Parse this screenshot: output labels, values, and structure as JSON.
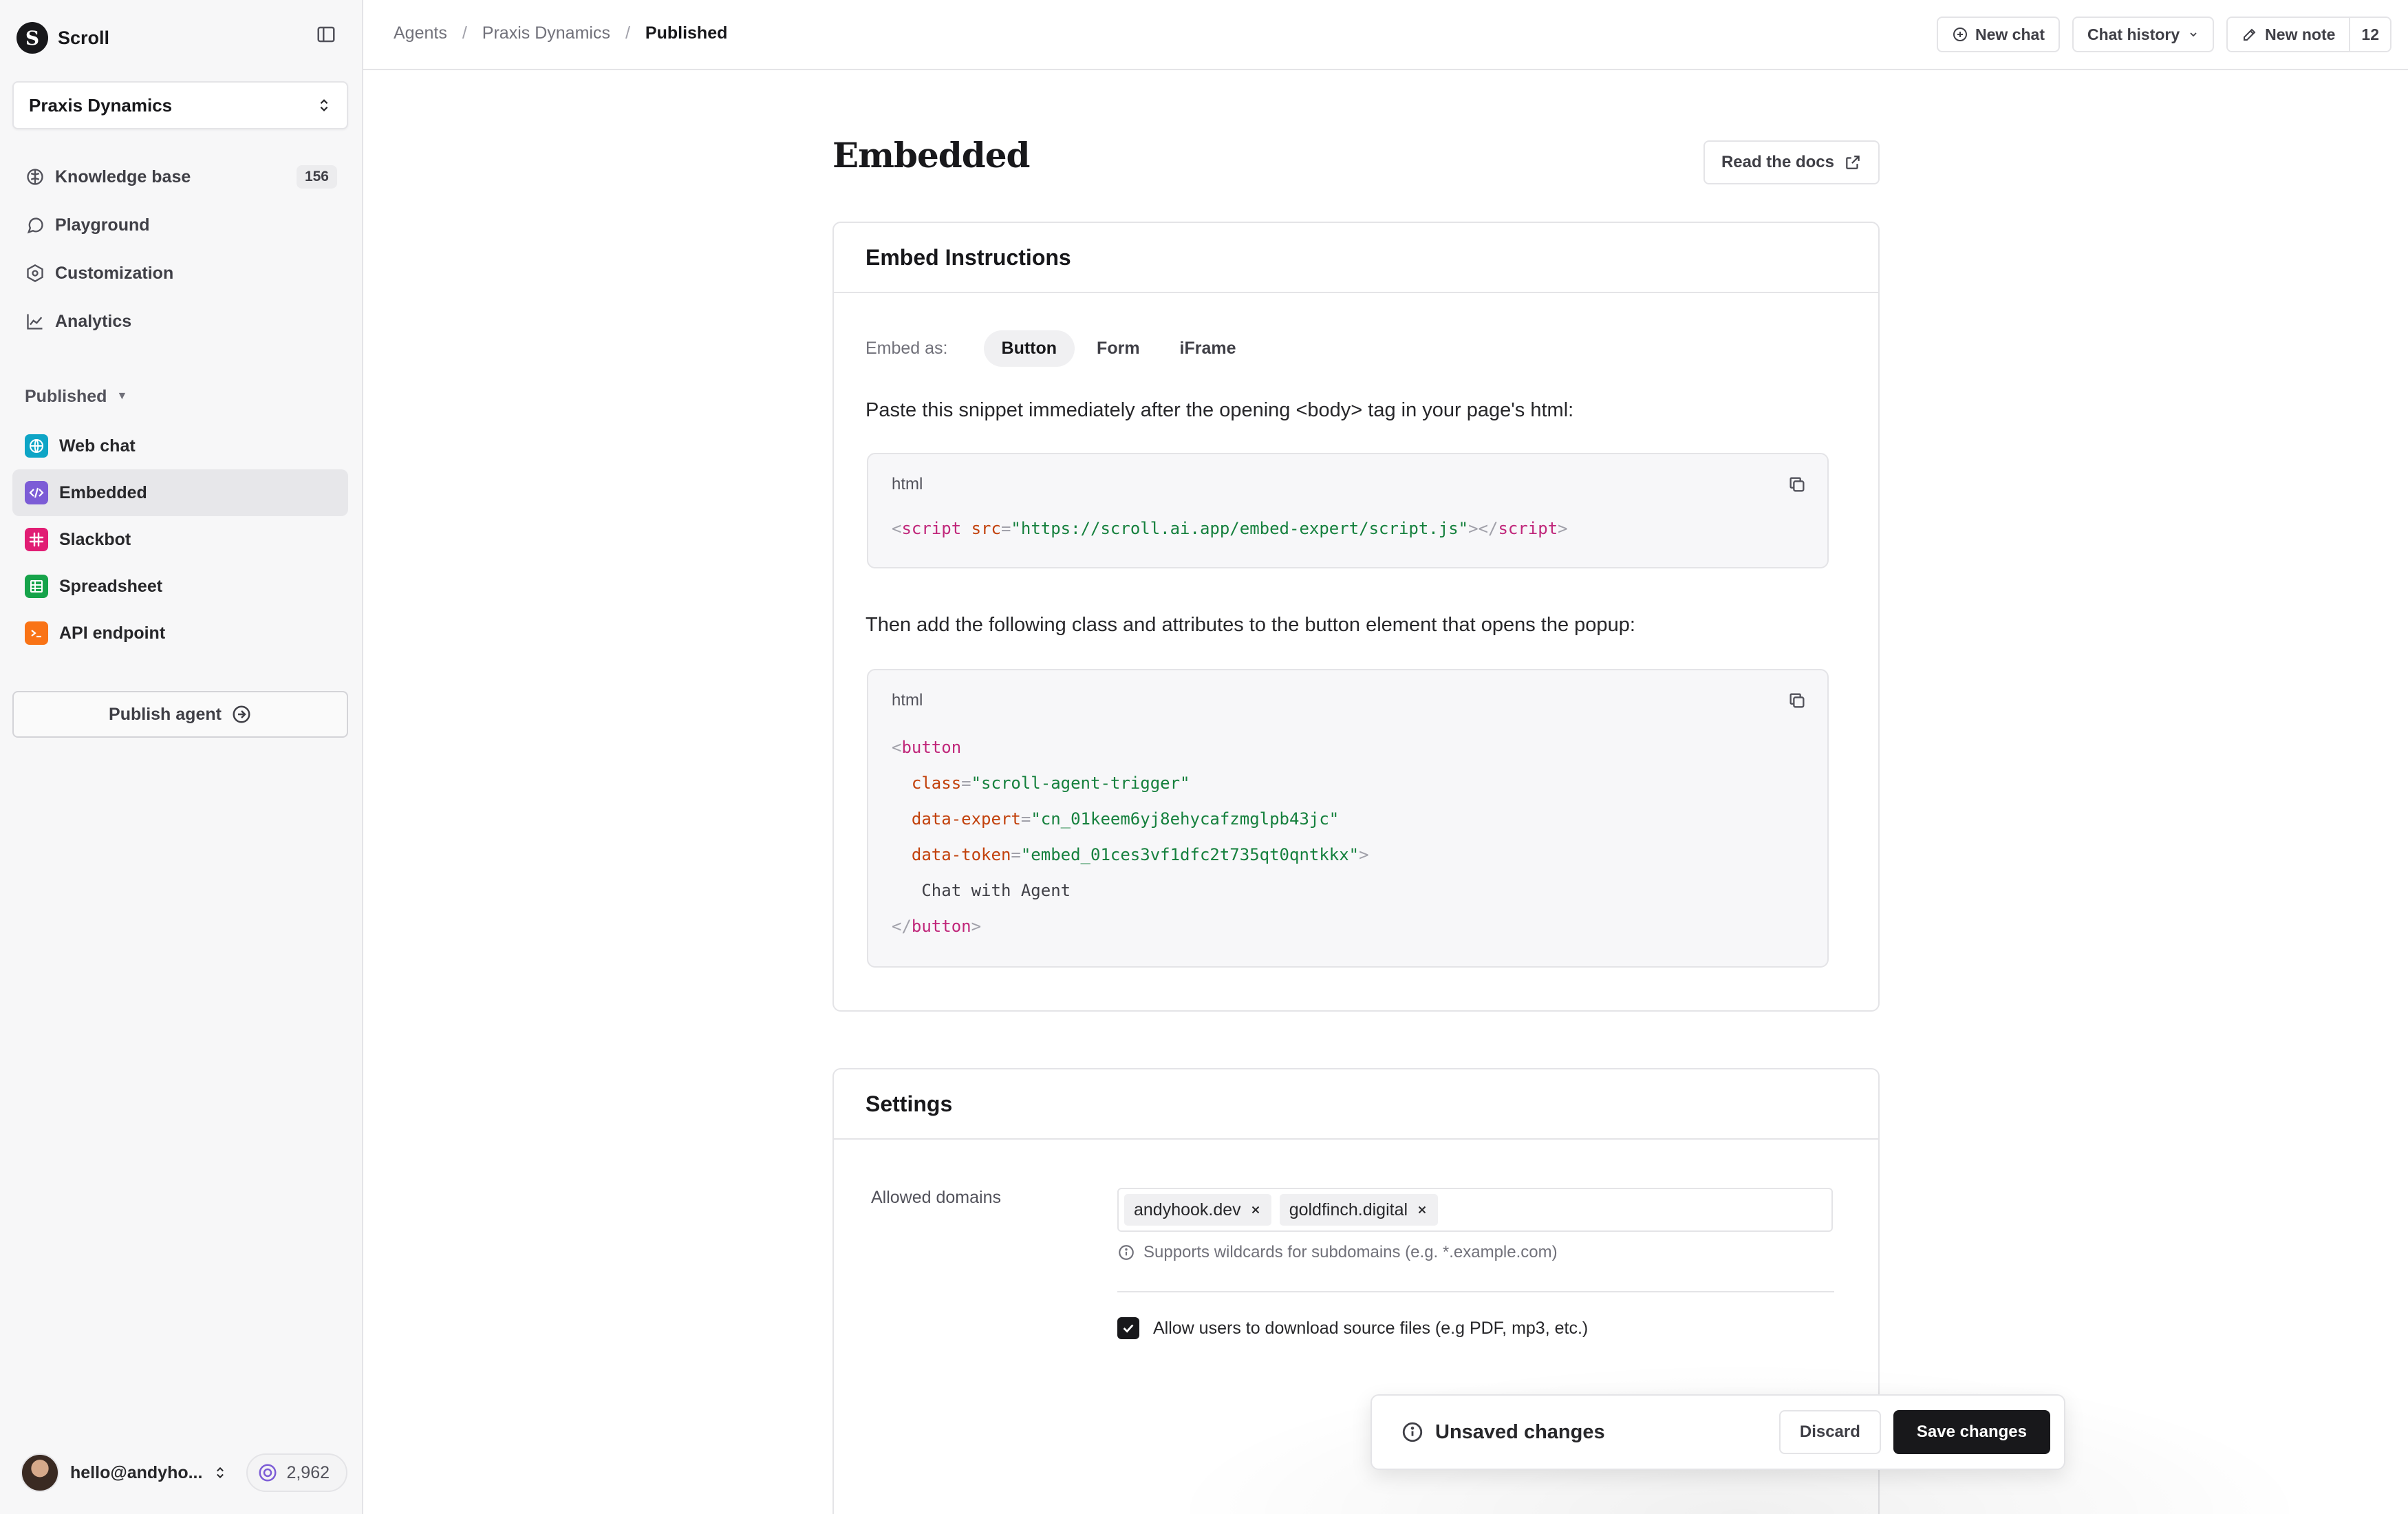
{
  "brand": {
    "name": "Scroll",
    "logo_letter": "S"
  },
  "workspace": {
    "name": "Praxis Dynamics"
  },
  "nav": {
    "items": [
      {
        "label": "Knowledge base",
        "icon": "brain-icon",
        "count": "156"
      },
      {
        "label": "Playground",
        "icon": "chat-bubble-icon"
      },
      {
        "label": "Customization",
        "icon": "hexagon-settings-icon"
      },
      {
        "label": "Analytics",
        "icon": "line-chart-icon"
      }
    ]
  },
  "published": {
    "section_label": "Published",
    "items": [
      {
        "label": "Web chat",
        "icon": "globe-icon",
        "color": "#0ea5c6"
      },
      {
        "label": "Embedded",
        "icon": "code-icon",
        "color": "#7c5cd6",
        "active": true
      },
      {
        "label": "Slackbot",
        "icon": "slack-icon",
        "color": "#e11d74"
      },
      {
        "label": "Spreadsheet",
        "icon": "table-icon",
        "color": "#16a34a"
      },
      {
        "label": "API endpoint",
        "icon": "terminal-icon",
        "color": "#f97316"
      }
    ]
  },
  "publish_button": {
    "label": "Publish agent"
  },
  "user": {
    "email": "hello@andyho...",
    "credits": "2,962"
  },
  "breadcrumb": {
    "items": [
      "Agents",
      "Praxis Dynamics"
    ],
    "current": "Published"
  },
  "topbar": {
    "new_chat": "New chat",
    "chat_history": "Chat history",
    "new_note": "New note",
    "note_count": "12"
  },
  "page": {
    "title": "Embedded",
    "docs_button": "Read the docs"
  },
  "embed": {
    "title": "Embed Instructions",
    "embed_as_label": "Embed as:",
    "tabs": [
      "Button",
      "Form",
      "iFrame"
    ],
    "active_tab": "Button",
    "instruction_1": "Paste this snippet immediately after the opening <body> tag in your page's html:",
    "code_lang_1": "html",
    "script_src": "\"https://scroll.ai.app/embed-expert/script.js\"",
    "instruction_2": "Then add the following class and attributes to the button element that opens the popup:",
    "code_lang_2": "html",
    "button_class": "\"scroll-agent-trigger\"",
    "data_expert": "\"cn_01keem6yj8ehycafzmglpb43jc\"",
    "data_token": "\"embed_01ces3vf1dfc2t735qt0qntkkx\"",
    "button_text": "Chat with Agent"
  },
  "settings": {
    "title": "Settings",
    "allowed_domains_label": "Allowed domains",
    "domains": [
      "andyhook.dev",
      "goldfinch.digital"
    ],
    "hint": "Supports wildcards for subdomains (e.g. *.example.com)",
    "download_checkbox_label": "Allow users to download source files (e.g PDF, mp3, etc.)",
    "download_checked": true
  },
  "unsaved": {
    "message": "Unsaved changes",
    "discard": "Discard",
    "save": "Save changes"
  },
  "colors": {
    "primary": "#18181b",
    "active_item_bg": "#e7e7ea",
    "border": "#e4e4e7"
  }
}
